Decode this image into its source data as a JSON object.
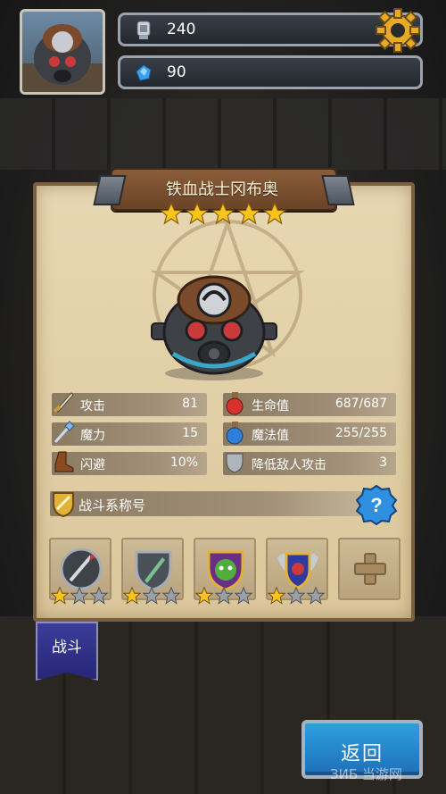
{
  "hud": {
    "trophy_value": "240",
    "gem_value": "90",
    "trophy_icon": "silver-trophy-icon",
    "gem_icon": "blue-crystal-icon",
    "settings_icon": "gear-icon"
  },
  "hero": {
    "name": "铁血战士冈布奥",
    "stars": 5
  },
  "stats": [
    {
      "label": "攻击",
      "value": "81",
      "icon": "sword-icon"
    },
    {
      "label": "生命值",
      "value": "687/687",
      "icon": "red-potion-icon"
    },
    {
      "label": "魔力",
      "value": "15",
      "icon": "magic-staff-icon"
    },
    {
      "label": "魔法值",
      "value": "255/255",
      "icon": "blue-potion-icon"
    },
    {
      "label": "闪避",
      "value": "10%",
      "icon": "boot-icon"
    },
    {
      "label": "降低敌人攻击",
      "value": "3",
      "icon": "shield-icon"
    }
  ],
  "title_bar": {
    "label": "战斗系称号",
    "icon": "gold-shield-icon",
    "help_icon": "question-mark-icon"
  },
  "skills": [
    {
      "icon": "spear-emblem-icon",
      "stars": 1
    },
    {
      "icon": "blade-shield-icon",
      "stars": 1
    },
    {
      "icon": "green-goblin-icon",
      "stars": 1
    },
    {
      "icon": "winged-shield-icon",
      "stars": 1
    },
    {
      "icon": "plus-icon",
      "stars": 0
    }
  ],
  "battle_tab": "战斗",
  "back_button": "返回",
  "watermark": "ЗИБ 当游网",
  "colors": {
    "star_gold": "#f7c51c",
    "star_gray": "#9aa0a6",
    "back_blue": "#2e9fe0",
    "battle_purple": "#2f3188"
  }
}
